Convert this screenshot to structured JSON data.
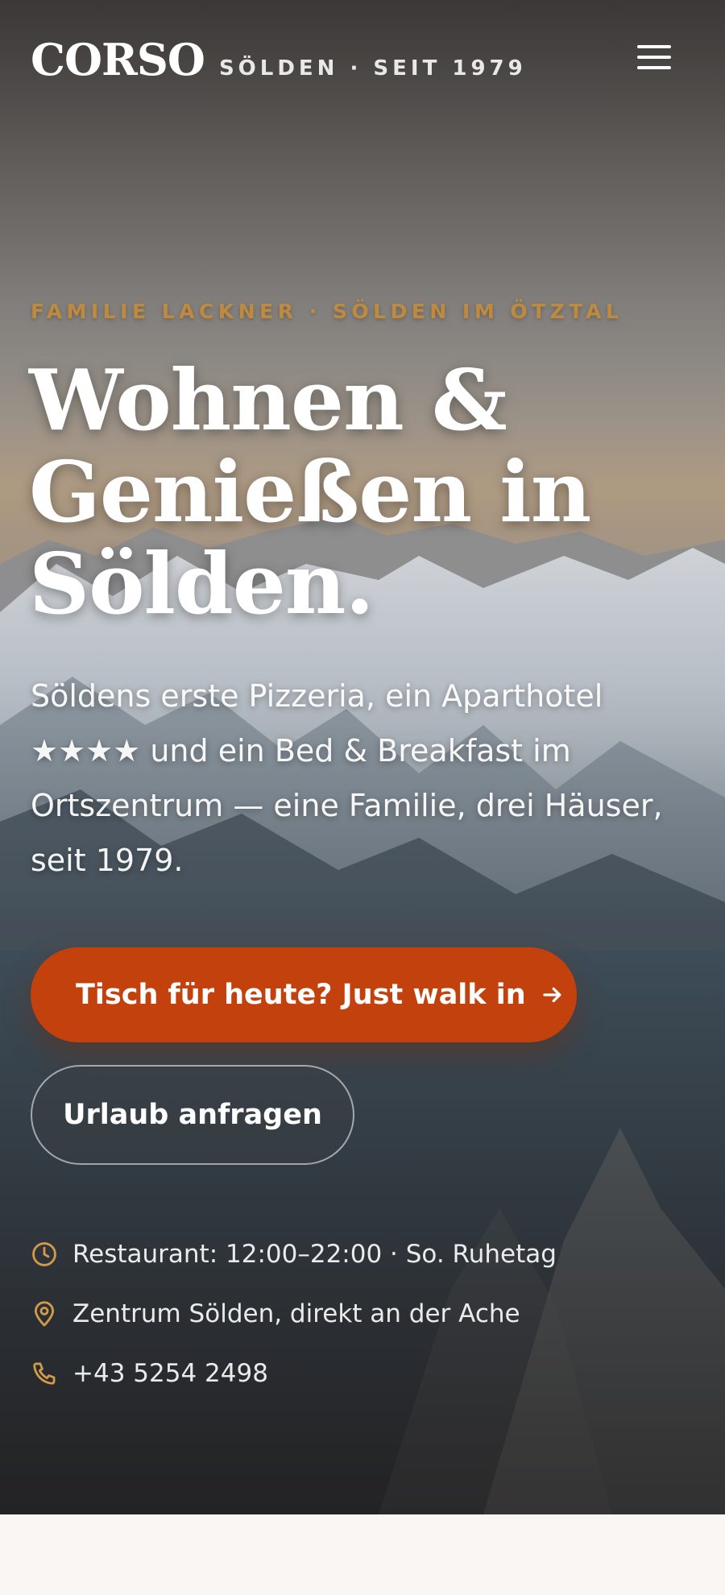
{
  "brand": {
    "logo": "CORSO",
    "tagline": "SÖLDEN · SEIT 1979"
  },
  "menu": {
    "icon": "hamburger-menu-icon"
  },
  "hero": {
    "eyebrow": "FAMILIE LACKNER · SÖLDEN IM ÖTZTAL",
    "headline_line1": "Wohnen &",
    "headline_line2": "Genießen in",
    "headline_line3": "Sölden.",
    "intro": "Söldens erste Pizzeria, ein Aparthotel ★★★★ und ein Bed & Breakfast im Ortszentrum — eine Familie, drei Häuser, seit 1979.",
    "primary_cta": "Tisch für heute? Just walk in",
    "secondary_cta": "Urlaub anfragen"
  },
  "info": [
    {
      "icon": "clock-icon",
      "text": "Restaurant: 12:00–22:00 · So. Ruhetag"
    },
    {
      "icon": "location-pin-icon",
      "text": "Zentrum Sölden, direkt an der Ache"
    },
    {
      "icon": "phone-icon",
      "text": "+43 5254 2498"
    }
  ],
  "colors": {
    "accent": "#c2410c",
    "eyebrow": "#c08a3e",
    "icon": "#d19a4a",
    "below_background": "#faf6f3"
  }
}
